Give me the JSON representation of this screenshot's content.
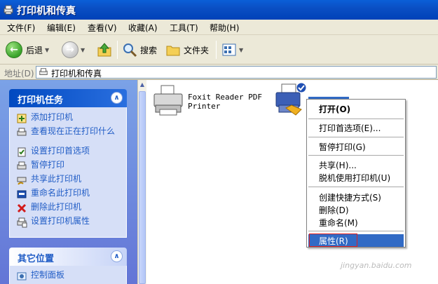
{
  "window": {
    "title": "打印机和传真"
  },
  "menubar": {
    "items": [
      "文件(F)",
      "编辑(E)",
      "查看(V)",
      "收藏(A)",
      "工具(T)",
      "帮助(H)"
    ]
  },
  "toolbar": {
    "back": "后退",
    "search": "搜索",
    "folders": "文件夹"
  },
  "address": {
    "label": "地址(D)",
    "value": "打印机和传真"
  },
  "left_pane": {
    "printer_tasks": {
      "title": "打印机任务",
      "items": [
        "添加打印机",
        "查看现在正在打印什么",
        "设置打印首选项",
        "暂停打印",
        "共享此打印机",
        "重命名此打印机",
        "删除此打印机",
        "设置打印机属性"
      ]
    },
    "other_places": {
      "title": "其它位置",
      "items": [
        "控制面板"
      ]
    }
  },
  "printers": [
    {
      "name_line1": "Foxit Reader PDF",
      "name_line2": "Printer"
    }
  ],
  "context_menu": {
    "items": [
      "打开(O)",
      "打印首选项(E)...",
      "暂停打印(G)",
      "共享(H)...",
      "脱机使用打印机(U)",
      "创建快捷方式(S)",
      "删除(D)",
      "重命名(M)",
      "属性(R)"
    ],
    "selected": "属性(R)"
  },
  "watermark": "jingyan.baidu.com",
  "colors": {
    "title_bar": "#0a4fc4",
    "task_link": "#215dc6",
    "menu_highlight": "#316ac5",
    "annotation_box": "#e02020"
  }
}
